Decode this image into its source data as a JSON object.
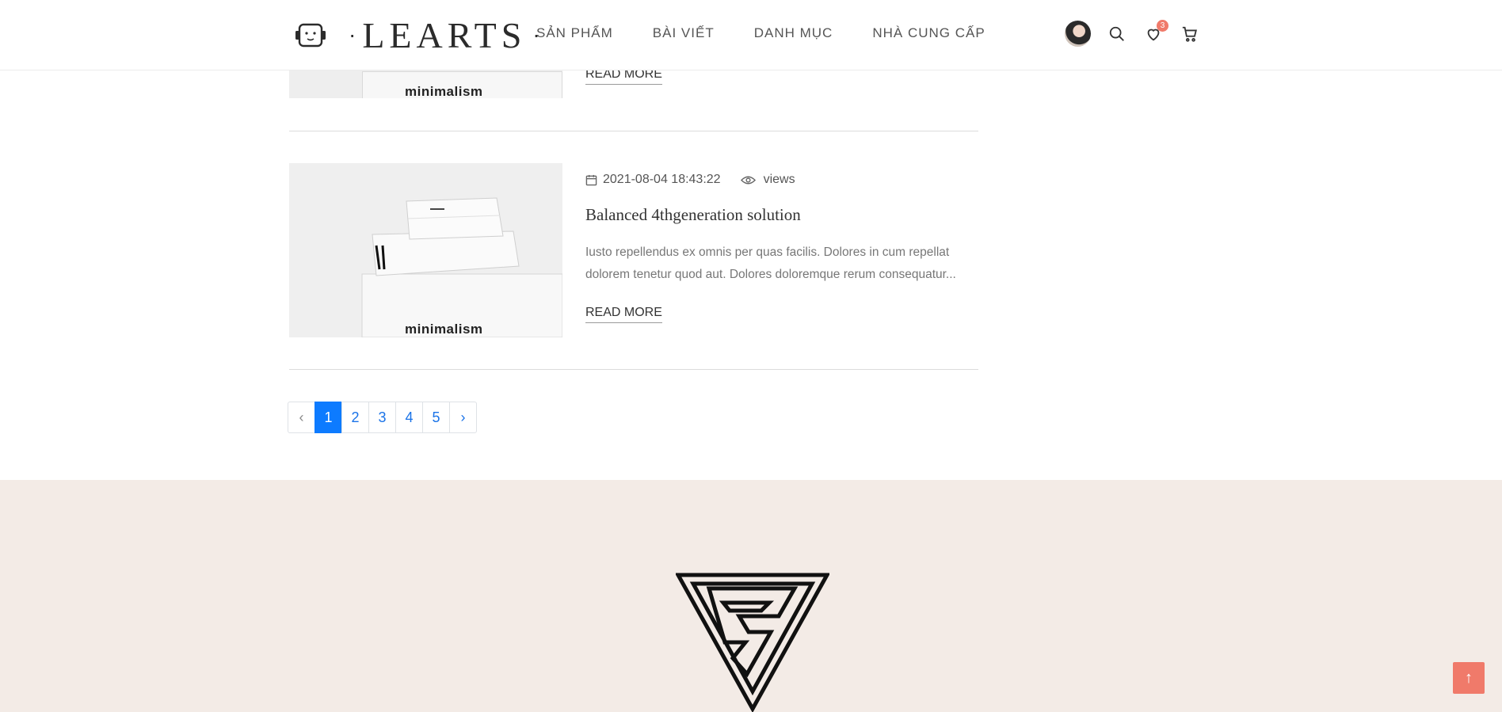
{
  "header": {
    "logo_text": "LEARTS",
    "nav": [
      {
        "label": "SẢN PHẨM"
      },
      {
        "label": "BÀI VIẾT"
      },
      {
        "label": "DANH MỤC"
      },
      {
        "label": "NHÀ CUNG CẤP"
      }
    ],
    "wishlist_count": "3",
    "icons": [
      "user-avatar",
      "search-icon",
      "heart-icon",
      "cart-icon"
    ]
  },
  "posts": [
    {
      "image_book_title": "minimalism",
      "read_more": "READ MORE"
    },
    {
      "date": "2021-08-04 18:43:22",
      "views_label": "views",
      "title": "Balanced 4thgeneration solution",
      "excerpt": "Iusto repellendus ex omnis per quas facilis. Dolores in cum repellat dolorem tenetur quod aut. Dolores doloremque rerum consequatur...",
      "image_book_title": "minimalism",
      "read_more": "READ MORE"
    }
  ],
  "pagination": {
    "prev": "‹",
    "pages": [
      "1",
      "2",
      "3",
      "4",
      "5"
    ],
    "active": "1",
    "next": "›"
  },
  "back_to_top": "↑",
  "colors": {
    "accent": "#f07a6a",
    "pagination_active": "#0d7bff",
    "footer_bg": "#f3ebe6"
  }
}
